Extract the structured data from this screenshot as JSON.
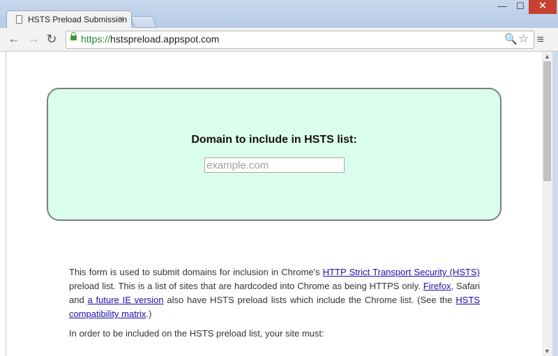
{
  "tab": {
    "title": "HSTS Preload Submission",
    "close": "×"
  },
  "window": {
    "minimize": "—",
    "maximize": "☐",
    "close": "✕"
  },
  "toolbar": {
    "back": "←",
    "forward": "→",
    "reload": "↻",
    "url_scheme": "https://",
    "url_host": "hstspreload.appspot.com",
    "zoom": "🔍",
    "star": "☆",
    "menu": "≡"
  },
  "form": {
    "label": "Domain to include in HSTS list:",
    "placeholder": "example.com"
  },
  "intro": {
    "t1": "This form is used to submit domains for inclusion in Chrome's ",
    "link_hsts": "HTTP Strict Transport Security (HSTS)",
    "t2": " preload list. This is a list of sites that are hardcoded into Chrome as being HTTPS only. ",
    "link_firefox": "Firefox",
    "t3": ", Safari and ",
    "link_ie": "a future IE version",
    "t4": " also have HSTS preload lists which include the Chrome list. (See the ",
    "link_matrix": "HSTS compatibility matrix",
    "t5": ".)"
  },
  "requirements_intro": "In order to be included on the HSTS preload list, your site must:"
}
